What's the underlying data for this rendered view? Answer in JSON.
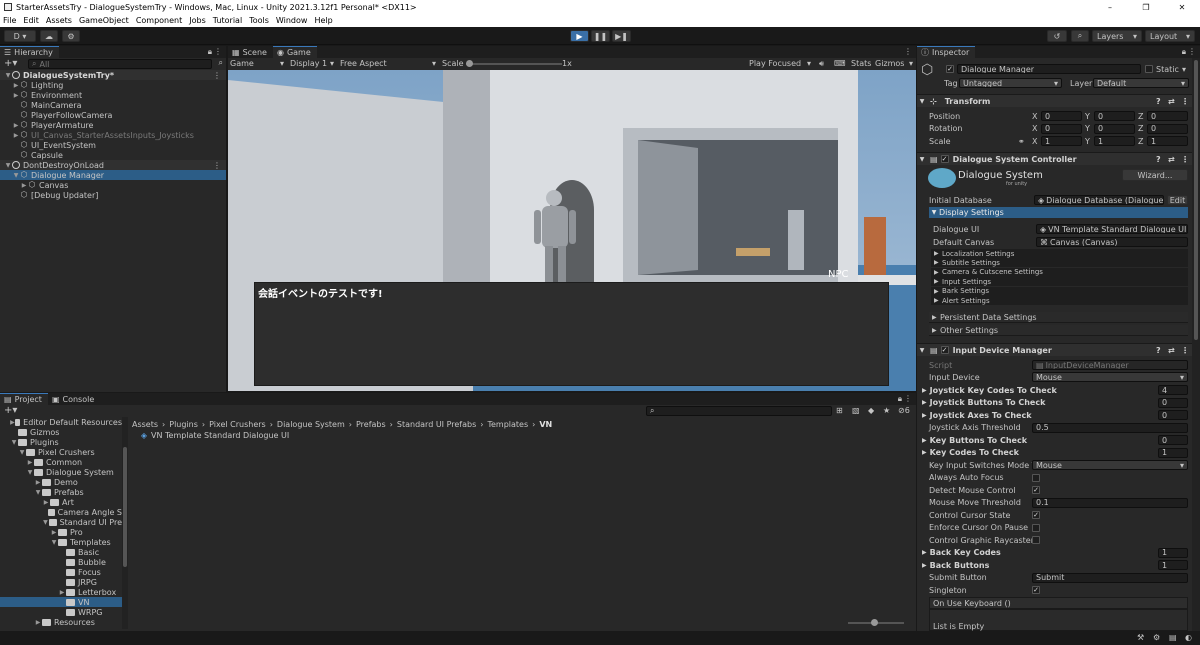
{
  "window": {
    "title": "StarterAssetsTry - DialogueSystemTry - Windows, Mac, Linux - Unity 2021.3.12f1 Personal* <DX11>",
    "minimize": "–",
    "maximize": "❐",
    "close": "✕"
  },
  "menu": [
    "File",
    "Edit",
    "Assets",
    "GameObject",
    "Component",
    "Jobs",
    "Tutorial",
    "Tools",
    "Window",
    "Help"
  ],
  "toolbar": {
    "account": "D ▾",
    "play": "▶",
    "pause": "❚❚",
    "step": "▶❚",
    "layers": "Layers",
    "layout": "Layout"
  },
  "hierarchy": {
    "tab": "Hierarchy",
    "search_placeholder": "All",
    "items": [
      {
        "label": "DialogueSystemTry*",
        "indent": 0,
        "type": "scene",
        "arrow": "▼",
        "bold": true
      },
      {
        "label": "Lighting",
        "indent": 2,
        "type": "obj",
        "arrow": "▶"
      },
      {
        "label": "Environment",
        "indent": 2,
        "type": "obj",
        "arrow": "▶"
      },
      {
        "label": "MainCamera",
        "indent": 2,
        "type": "obj",
        "arrow": ""
      },
      {
        "label": "PlayerFollowCamera",
        "indent": 2,
        "type": "obj",
        "arrow": ""
      },
      {
        "label": "PlayerArmature",
        "indent": 2,
        "type": "obj",
        "arrow": "▶"
      },
      {
        "label": "UI_Canvas_StarterAssetsInputs_Joysticks",
        "indent": 2,
        "type": "obj",
        "arrow": "▶",
        "dim": true
      },
      {
        "label": "UI_EventSystem",
        "indent": 2,
        "type": "obj",
        "arrow": ""
      },
      {
        "label": "Capsule",
        "indent": 2,
        "type": "obj",
        "arrow": ""
      },
      {
        "label": "DontDestroyOnLoad",
        "indent": 0,
        "type": "scene",
        "arrow": "▼",
        "bold": false
      },
      {
        "label": "Dialogue Manager",
        "indent": 2,
        "type": "obj",
        "arrow": "▼",
        "selected": true
      },
      {
        "label": "Canvas",
        "indent": 3,
        "type": "obj",
        "arrow": "▶"
      },
      {
        "label": "[Debug Updater]",
        "indent": 2,
        "type": "obj",
        "arrow": ""
      }
    ]
  },
  "scene_tabs": {
    "scene": "Scene",
    "game": "Game"
  },
  "game_bar": {
    "display_mode": "Game",
    "display": "Display 1",
    "aspect": "Free Aspect",
    "scale_label": "Scale",
    "scale_value": "1x",
    "play_focused": "Play Focused",
    "stats": "Stats",
    "gizmos": "Gizmos"
  },
  "game_view": {
    "npc_label": "NPC",
    "dialogue_text": "会話イベントのテストです!"
  },
  "project": {
    "tab_project": "Project",
    "tab_console": "Console",
    "tree": [
      {
        "label": "Editor Default Resources",
        "indent": 1,
        "arrow": "▶"
      },
      {
        "label": "Gizmos",
        "indent": 1,
        "arrow": ""
      },
      {
        "label": "Plugins",
        "indent": 1,
        "arrow": "▼"
      },
      {
        "label": "Pixel Crushers",
        "indent": 2,
        "arrow": "▼"
      },
      {
        "label": "Common",
        "indent": 3,
        "arrow": "▶"
      },
      {
        "label": "Dialogue System",
        "indent": 3,
        "arrow": "▼"
      },
      {
        "label": "Demo",
        "indent": 4,
        "arrow": "▶"
      },
      {
        "label": "Prefabs",
        "indent": 4,
        "arrow": "▼"
      },
      {
        "label": "Art",
        "indent": 5,
        "arrow": "▶"
      },
      {
        "label": "Camera Angle S",
        "indent": 5,
        "arrow": ""
      },
      {
        "label": "Standard UI Pre",
        "indent": 5,
        "arrow": "▼"
      },
      {
        "label": "Pro",
        "indent": 6,
        "arrow": "▶"
      },
      {
        "label": "Templates",
        "indent": 6,
        "arrow": "▼"
      },
      {
        "label": "Basic",
        "indent": 7,
        "arrow": ""
      },
      {
        "label": "Bubble",
        "indent": 7,
        "arrow": ""
      },
      {
        "label": "Focus",
        "indent": 7,
        "arrow": ""
      },
      {
        "label": "JRPG",
        "indent": 7,
        "arrow": ""
      },
      {
        "label": "Letterbox",
        "indent": 7,
        "arrow": "▶"
      },
      {
        "label": "VN",
        "indent": 7,
        "arrow": "",
        "selected": true
      },
      {
        "label": "WRPG",
        "indent": 7,
        "arrow": ""
      },
      {
        "label": "Resources",
        "indent": 4,
        "arrow": "▶"
      }
    ],
    "breadcrumb": [
      "Assets",
      "Plugins",
      "Pixel Crushers",
      "Dialogue System",
      "Prefabs",
      "Standard UI Prefabs",
      "Templates",
      "VN"
    ],
    "asset": "VN Template Standard Dialogue UI",
    "hidden_count": "6"
  },
  "inspector": {
    "tab": "Inspector",
    "object_name": "Dialogue Manager",
    "static": "Static",
    "tag_label": "Tag",
    "tag_value": "Untagged",
    "layer_label": "Layer",
    "layer_value": "Default",
    "transform": {
      "title": "Transform",
      "rows": [
        {
          "label": "Position",
          "x": "0",
          "y": "0",
          "z": "0"
        },
        {
          "label": "Rotation",
          "x": "0",
          "y": "0",
          "z": "0"
        },
        {
          "label": "Scale",
          "x": "1",
          "y": "1",
          "z": "1"
        }
      ]
    },
    "dsc": {
      "title": "Dialogue System Controller",
      "logo": "Dialogue System",
      "logo_sub": "for unity",
      "wizard": "Wizard...",
      "initial_db_label": "Initial Database",
      "initial_db_value": "Dialogue Database (Dialogue Da",
      "edit": "Edit",
      "display_settings": "Display Settings",
      "dialogue_ui_label": "Dialogue UI",
      "dialogue_ui_value": "VN Template Standard Dialogue UI",
      "default_canvas_label": "Default Canvas",
      "default_canvas_value": "Canvas (Canvas)",
      "subsections": [
        "Localization Settings",
        "Subtitle Settings",
        "Camera & Cutscene Settings",
        "Input Settings",
        "Bark Settings",
        "Alert Settings"
      ],
      "persistent": "Persistent Data Settings",
      "other": "Other Settings"
    },
    "idm": {
      "title": "Input Device Manager",
      "script_label": "Script",
      "script_value": "InputDeviceManager",
      "input_device_label": "Input Device",
      "input_device_value": "Mouse",
      "rows": [
        {
          "label": "Joystick Key Codes To Check",
          "value": "4",
          "bold": true,
          "kind": "num"
        },
        {
          "label": "Joystick Buttons To Check",
          "value": "0",
          "bold": true,
          "kind": "num"
        },
        {
          "label": "Joystick Axes To Check",
          "value": "0",
          "bold": true,
          "kind": "num"
        },
        {
          "label": "Joystick Axis Threshold",
          "value": "0.5",
          "bold": false,
          "kind": "text"
        },
        {
          "label": "Key Buttons To Check",
          "value": "0",
          "bold": true,
          "kind": "num"
        },
        {
          "label": "Key Codes To Check",
          "value": "1",
          "bold": true,
          "kind": "num"
        },
        {
          "label": "Key Input Switches Mode To",
          "value": "Mouse",
          "bold": false,
          "kind": "dropdown"
        },
        {
          "label": "Always Auto Focus",
          "value": "",
          "bold": false,
          "kind": "check"
        },
        {
          "label": "Detect Mouse Control",
          "value": "✓",
          "bold": false,
          "kind": "check"
        },
        {
          "label": "Mouse Move Threshold",
          "value": "0.1",
          "bold": false,
          "kind": "text"
        },
        {
          "label": "Control Cursor State",
          "value": "✓",
          "bold": false,
          "kind": "check"
        },
        {
          "label": "Enforce Cursor On Pause",
          "value": "",
          "bold": false,
          "kind": "check"
        },
        {
          "label": "Control Graphic Raycasters",
          "value": "",
          "bold": false,
          "kind": "check"
        },
        {
          "label": "Back Key Codes",
          "value": "1",
          "bold": true,
          "kind": "num"
        },
        {
          "label": "Back Buttons",
          "value": "1",
          "bold": true,
          "kind": "num"
        },
        {
          "label": "Submit Button",
          "value": "Submit",
          "bold": false,
          "kind": "text"
        },
        {
          "label": "Singleton",
          "value": "✓",
          "bold": false,
          "kind": "check"
        }
      ],
      "event": "On Use Keyboard ()",
      "list_empty": "List is Empty"
    }
  }
}
